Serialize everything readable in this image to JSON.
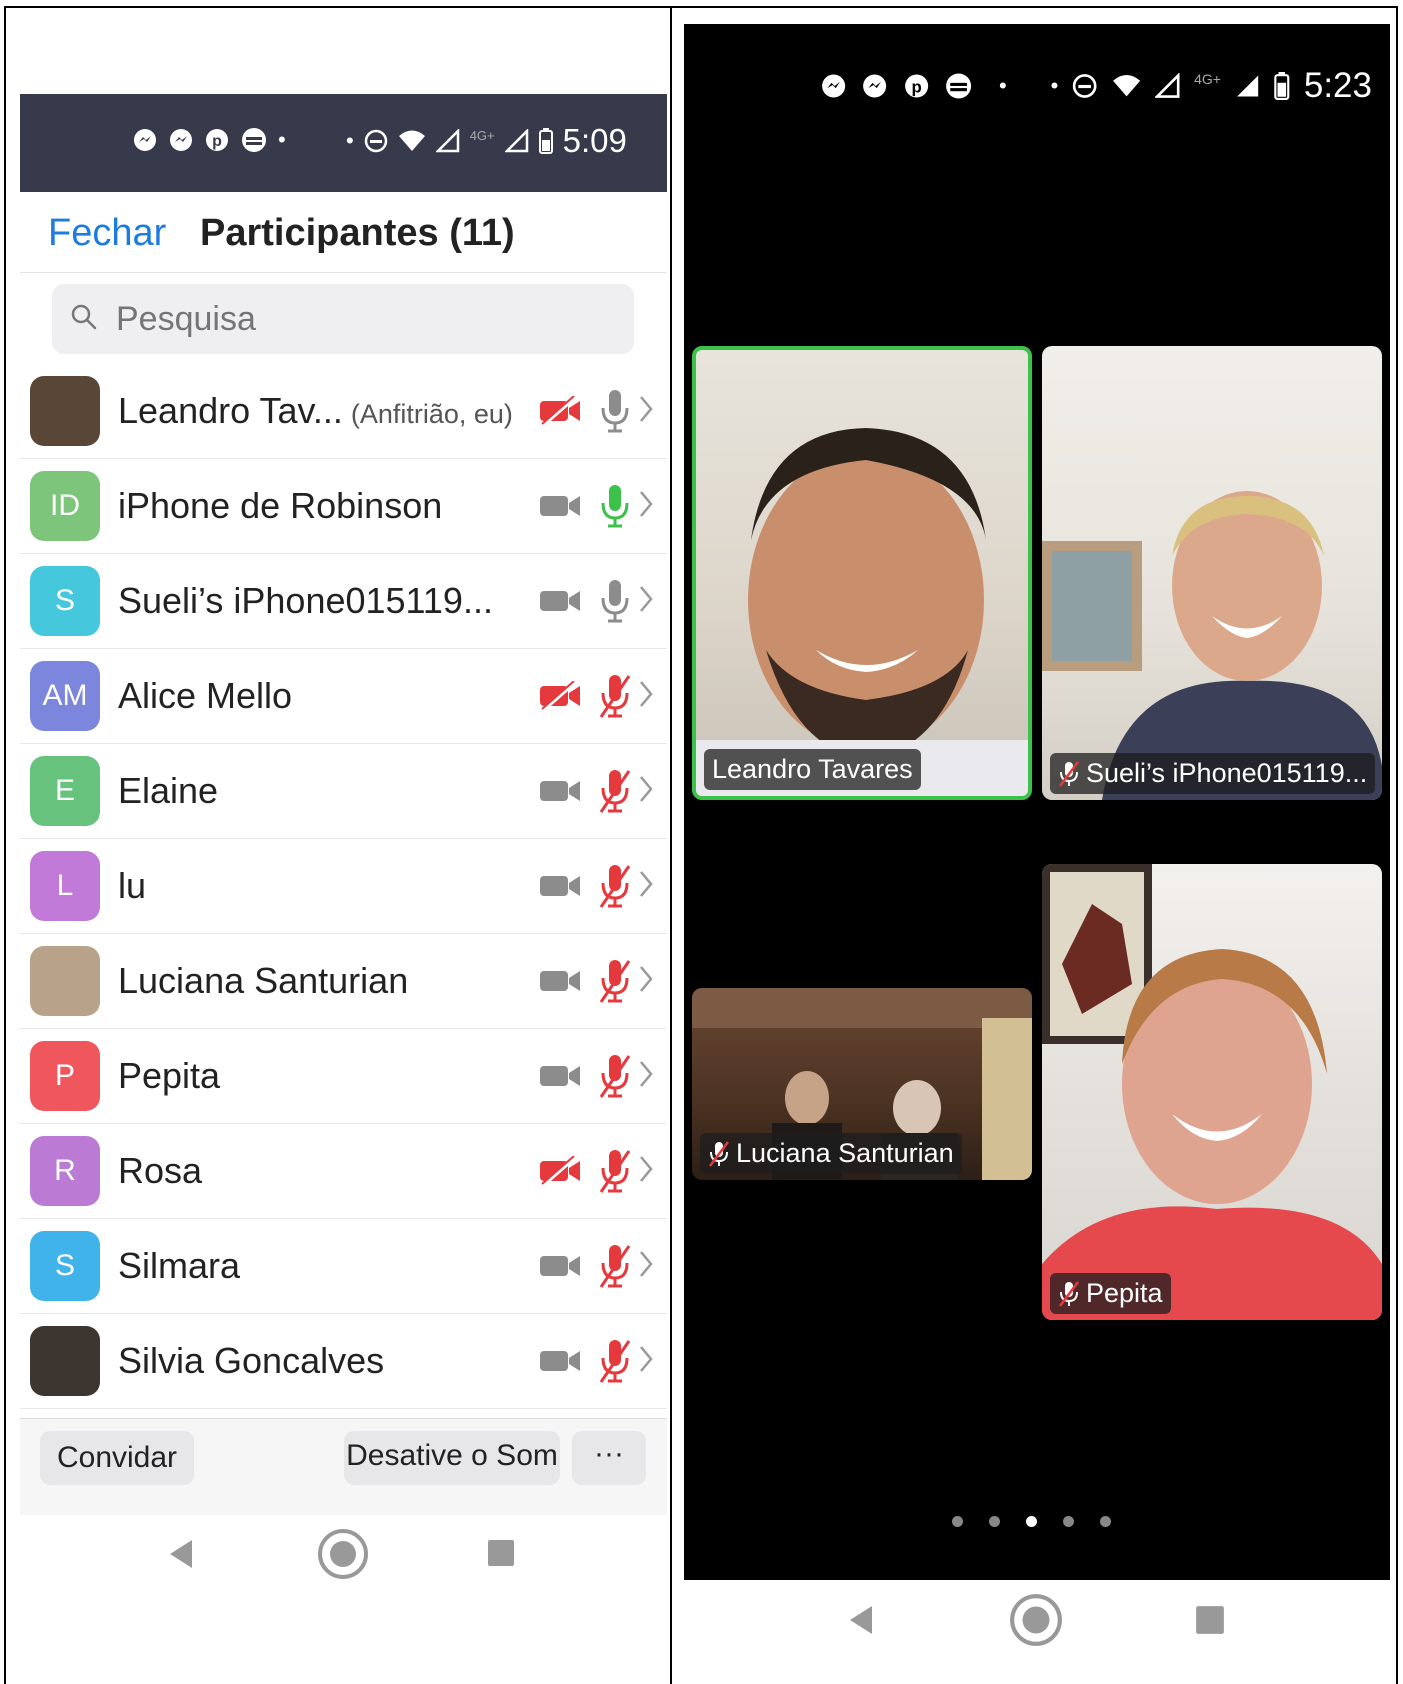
{
  "left": {
    "status_bar": {
      "time": "5:09",
      "network": "4G+",
      "icons": [
        "messenger-icon",
        "messenger-icon",
        "pinterest-icon",
        "app-icon",
        "dot-icon",
        "dnd-icon",
        "wifi-icon",
        "signal-icon",
        "signal-icon",
        "battery-icon"
      ]
    },
    "header": {
      "close_label": "Fechar",
      "title": "Participantes (11)"
    },
    "search": {
      "placeholder": "Pesquisa"
    },
    "participants": [
      {
        "name": "Leandro Tav...",
        "role": "(Anfitrião, eu)",
        "avatar_initials": "",
        "avatar_color": "#5a4636",
        "video_off": true,
        "mic_state": "idle"
      },
      {
        "name": "iPhone de Robinson",
        "role": "",
        "avatar_initials": "ID",
        "avatar_color": "#7cc57a",
        "video_off": false,
        "mic_state": "active"
      },
      {
        "name": "Sueli’s iPhone015119...",
        "role": "",
        "avatar_initials": "S",
        "avatar_color": "#45c8dc",
        "video_off": false,
        "mic_state": "idle"
      },
      {
        "name": "Alice Mello",
        "role": "",
        "avatar_initials": "AM",
        "avatar_color": "#7b86dc",
        "video_off": true,
        "mic_state": "muted"
      },
      {
        "name": "Elaine",
        "role": "",
        "avatar_initials": "E",
        "avatar_color": "#66c27c",
        "video_off": false,
        "mic_state": "muted"
      },
      {
        "name": "lu",
        "role": "",
        "avatar_initials": "L",
        "avatar_color": "#c27ad8",
        "video_off": false,
        "mic_state": "muted"
      },
      {
        "name": "Luciana Santurian",
        "role": "",
        "avatar_initials": "",
        "avatar_color": "#b8a38a",
        "video_off": false,
        "mic_state": "muted"
      },
      {
        "name": "Pepita",
        "role": "",
        "avatar_initials": "P",
        "avatar_color": "#f0575c",
        "video_off": false,
        "mic_state": "muted"
      },
      {
        "name": "Rosa",
        "role": "",
        "avatar_initials": "R",
        "avatar_color": "#bb7ad3",
        "video_off": true,
        "mic_state": "muted"
      },
      {
        "name": "Silmara",
        "role": "",
        "avatar_initials": "S",
        "avatar_color": "#3fb3ea",
        "video_off": false,
        "mic_state": "muted"
      },
      {
        "name": "Silvia Goncalves",
        "role": "",
        "avatar_initials": "",
        "avatar_color": "#3d3530",
        "video_off": false,
        "mic_state": "muted"
      }
    ],
    "footer": {
      "invite_label": "Convidar",
      "mute_all_label": "Desative o Som de",
      "more_label": "···"
    }
  },
  "right": {
    "status_bar": {
      "time": "5:23",
      "network": "4G+"
    },
    "tiles": [
      {
        "label": "Leandro Tavares",
        "muted": false,
        "active_speaker": true
      },
      {
        "label": "Sueli’s iPhone015119...",
        "muted": true,
        "active_speaker": false
      },
      {
        "label": "Luciana Santurian",
        "muted": true,
        "active_speaker": false
      },
      {
        "label": "Pepita",
        "muted": true,
        "active_speaker": false
      }
    ],
    "page_dots": {
      "count": 5,
      "active_index": 2
    }
  },
  "colors": {
    "accent_blue": "#1c7ce0",
    "muted_red": "#e5393d",
    "active_green": "#3cc24a",
    "status_bar_left": "#363a4b"
  }
}
